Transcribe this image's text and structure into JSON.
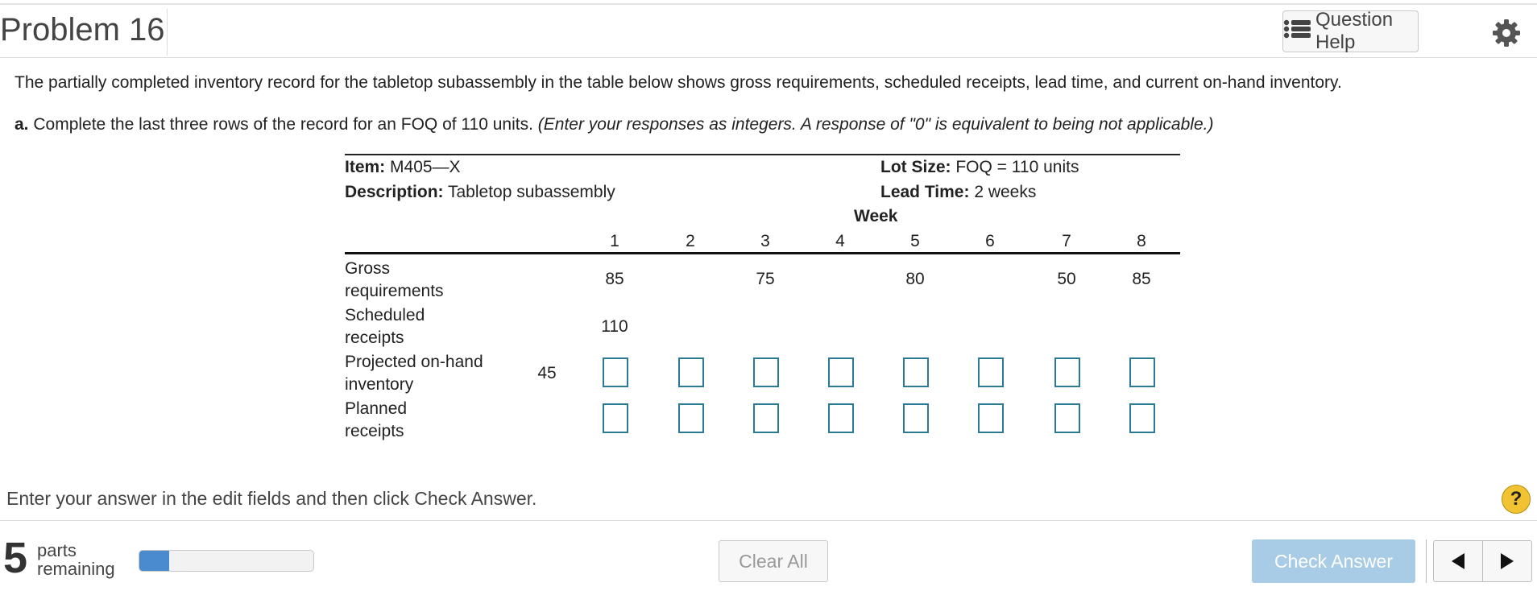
{
  "header": {
    "title": "Problem 16",
    "help_button_label": "Question Help",
    "help_button_icon": "list-icon",
    "settings_icon": "gear-icon"
  },
  "question": {
    "intro": "The partially completed inventory record for the tabletop subassembly in the table below shows gross requirements, scheduled receipts, lead time, and current on-hand inventory.",
    "part_a_label": "a.",
    "part_a_text": "Complete the last three rows of the record for an FOQ of 110 units.",
    "part_a_note": "(Enter your responses as integers. A response of \"0\" is equivalent to being not applicable.)"
  },
  "record": {
    "item_label": "Item:",
    "item_value": "M405—X",
    "lot_size_label": "Lot Size:",
    "lot_size_value": "FOQ = 110 units",
    "description_label": "Description:",
    "description_value": "Tabletop subassembly",
    "lead_time_label": "Lead Time:",
    "lead_time_value": "2 weeks",
    "week_label": "Week",
    "weeks": [
      "1",
      "2",
      "3",
      "4",
      "5",
      "6",
      "7",
      "8"
    ],
    "rows": {
      "gross": {
        "label_line1": "Gross",
        "label_line2": "requirements",
        "values": [
          "85",
          "",
          "75",
          "",
          "80",
          "",
          "50",
          "85"
        ]
      },
      "scheduled": {
        "label_line1": "Scheduled",
        "label_line2": "receipts",
        "values": [
          "110",
          "",
          "",
          "",
          "",
          "",
          "",
          ""
        ]
      },
      "projected": {
        "label_line1": "Projected on-hand",
        "label_line2": "inventory",
        "initial": "45",
        "values": [
          "",
          "",
          "",
          "",
          "",
          "",
          "",
          ""
        ]
      },
      "planned": {
        "label_line1": "Planned",
        "label_line2": "receipts",
        "values": [
          "",
          "",
          "",
          "",
          "",
          "",
          "",
          ""
        ]
      }
    }
  },
  "footer": {
    "instructions": "Enter your answer in the edit fields and then click Check Answer.",
    "help_icon_text": "?",
    "parts_count": "5",
    "parts_line1": "parts",
    "parts_line2": "remaining",
    "progress_fraction": 0.17,
    "clear_all_label": "Clear All",
    "check_answer_label": "Check Answer",
    "prev_icon": "left-arrow-icon",
    "next_icon": "right-arrow-icon"
  },
  "colors": {
    "input_border": "#2b7a93",
    "progress_fill": "#4a8bd0",
    "check_button": "#a8cbe6",
    "help_circle": "#f1c232"
  }
}
